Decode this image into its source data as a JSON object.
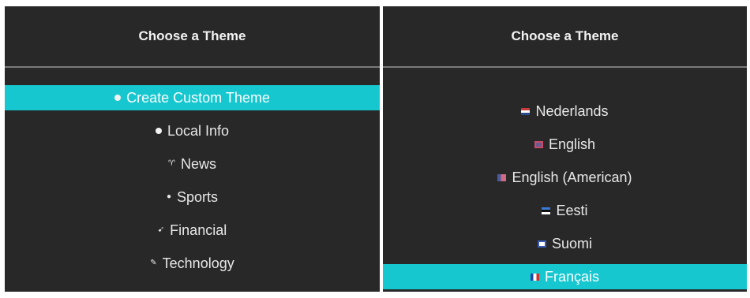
{
  "left_panel": {
    "title": "Choose a Theme",
    "items": [
      {
        "label": "Create Custom Theme",
        "icon": "dot-icon",
        "selected": true
      },
      {
        "label": "Local Info",
        "icon": "dot-icon",
        "selected": false
      },
      {
        "label": "News",
        "icon": "news-icon",
        "selected": false
      },
      {
        "label": "Sports",
        "icon": "sports-icon",
        "selected": false
      },
      {
        "label": "Financial",
        "icon": "financial-icon",
        "selected": false
      },
      {
        "label": "Technology",
        "icon": "technology-icon",
        "selected": false
      }
    ]
  },
  "right_panel": {
    "title": "Choose a Theme",
    "items": [
      {
        "label": "Nederlands",
        "icon": "flag-netherlands-icon",
        "selected": false
      },
      {
        "label": "English",
        "icon": "flag-uk-icon",
        "selected": false
      },
      {
        "label": "English (American)",
        "icon": "flag-us-icon",
        "selected": false
      },
      {
        "label": "Eesti",
        "icon": "flag-estonia-icon",
        "selected": false
      },
      {
        "label": "Suomi",
        "icon": "flag-finland-icon",
        "selected": false
      },
      {
        "label": "Français",
        "icon": "flag-france-icon",
        "selected": true
      }
    ]
  },
  "colors": {
    "panel_bg": "#282828",
    "highlight": "#16c7cf",
    "text": "#e8e8e8"
  }
}
